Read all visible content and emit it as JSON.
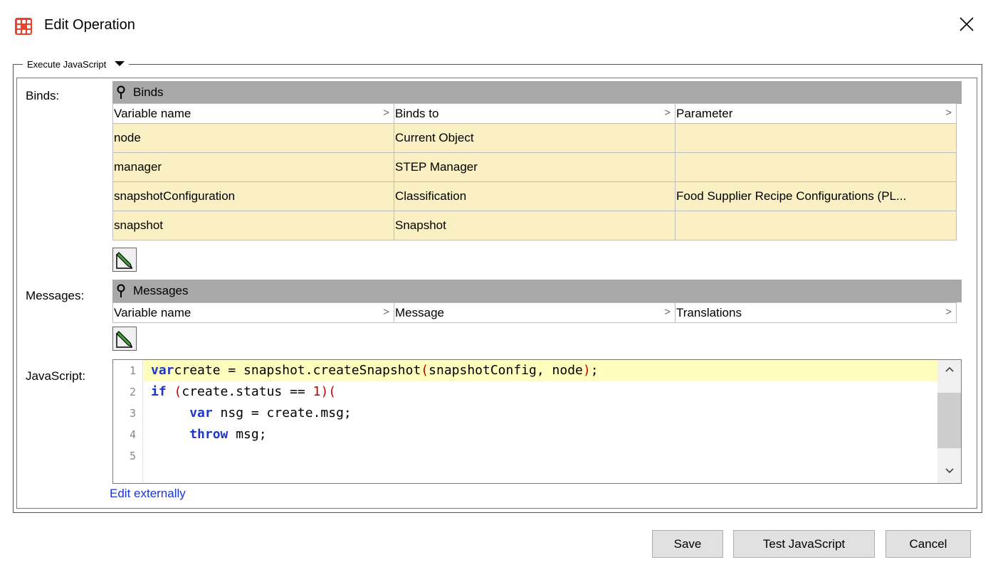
{
  "window": {
    "title": "Edit Operation",
    "close_glyph": "✕"
  },
  "group": {
    "legend": "Execute JavaScript"
  },
  "labels": {
    "binds": "Binds:",
    "messages": "Messages:",
    "javascript": "JavaScript:"
  },
  "binds": {
    "panel_title": "Binds",
    "columns": [
      "Variable name",
      "Binds to",
      "Parameter"
    ],
    "rows": [
      [
        "node",
        "Current Object",
        ""
      ],
      [
        "manager",
        "STEP Manager",
        ""
      ],
      [
        "snapshotConfiguration",
        "Classification",
        "Food Supplier Recipe Configurations (PL..."
      ],
      [
        "snapshot",
        "Snapshot",
        ""
      ]
    ]
  },
  "messages": {
    "panel_title": "Messages",
    "columns": [
      "Variable name",
      "Message",
      "Translations"
    ]
  },
  "editor": {
    "line_numbers": [
      "1",
      "2",
      "3",
      "4",
      "5"
    ],
    "lines": [
      {
        "indent": "",
        "tokens": [
          [
            "kw",
            "var"
          ],
          [
            "",
            "create = snapshot.createSnapshot"
          ],
          [
            "pn",
            "("
          ],
          [
            "",
            "snapshotConfig, node"
          ],
          [
            "pn",
            ")"
          ],
          [
            "",
            ";"
          ]
        ]
      },
      {
        "indent": "",
        "tokens": [
          [
            "kw",
            "if"
          ],
          [
            "",
            " "
          ],
          [
            "pn",
            "("
          ],
          [
            "",
            "create.status == "
          ],
          [
            "nm",
            "1"
          ],
          [
            "pn",
            ")("
          ]
        ]
      },
      {
        "indent": "     ",
        "tokens": [
          [
            "kw",
            "var"
          ],
          [
            "",
            " nsg = create.msg;"
          ]
        ]
      },
      {
        "indent": "     ",
        "tokens": [
          [
            "kw",
            "throw"
          ],
          [
            "",
            " msg;"
          ]
        ]
      },
      {
        "indent": "",
        "tokens": []
      }
    ],
    "edit_externally": "Edit externally"
  },
  "buttons": {
    "save": "Save",
    "test": "Test JavaScript",
    "cancel": "Cancel"
  },
  "colors": {
    "app_icon": "#e8442d",
    "row_bg": "#faf0c3",
    "panel_header": "#a8a8a8",
    "active_line": "#fefdbd",
    "keyword": "#1f36c8",
    "paren": "#c00000",
    "link": "#1a35d6"
  },
  "icons": {
    "app": "app-grid-icon",
    "close": "close-icon",
    "pin": "pin-icon",
    "edit": "edit-pencil-icon",
    "chevron": "chevron-right-icon",
    "scroll_up": "scroll-up-icon",
    "scroll_down": "scroll-down-icon"
  }
}
